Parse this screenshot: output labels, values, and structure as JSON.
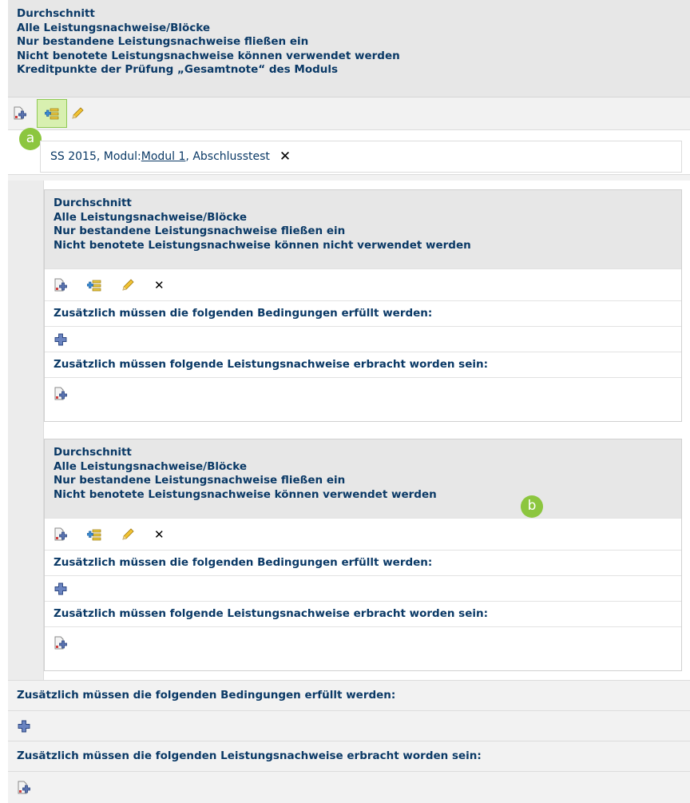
{
  "outer": {
    "header_lines": [
      "Durchschnitt",
      "Alle Leistungsnachweise/Blöcke",
      "Nur bestandene Leistungsnachweise fließen ein",
      "Nicht benotete Leistungsnachweise können verwendet werden",
      "Kreditpunkte der Prüfung „Gesamtnote“ des Moduls"
    ],
    "badge_a": "a",
    "selected": {
      "prefix": "SS 2015, Modul: ",
      "link": "Modul 1",
      "suffix": ", Abschlusstest",
      "remove": "✕"
    },
    "conditions_label": "Zusätzlich müssen die folgenden Bedingungen erfüllt werden:",
    "achievements_label": "Zusätzlich müssen die folgenden Leistungsnachweise erbracht worden sein:"
  },
  "blocks": [
    {
      "header_lines": [
        "Durchschnitt",
        "Alle Leistungsnachweise/Blöcke",
        "Nur bestandene Leistungsnachweise fließen ein",
        "Nicht benotete Leistungsnachweise können nicht verwendet werden"
      ],
      "conditions_label": "Zusätzlich müssen die folgenden Bedingungen erfüllt werden:",
      "achievements_label": "Zusätzlich müssen folgende Leistungsnachweise erbracht worden sein:",
      "remove": "✕"
    },
    {
      "header_lines": [
        "Durchschnitt",
        "Alle Leistungsnachweise/Blöcke",
        "Nur bestandene Leistungsnachweise fließen ein",
        "Nicht benotete Leistungsnachweise können verwendet werden"
      ],
      "badge_b": "b",
      "conditions_label": "Zusätzlich müssen die folgenden Bedingungen erfüllt werden:",
      "achievements_label": "Zusätzlich müssen folgende Leistungsnachweise erbracht worden sein:",
      "remove": "✕"
    }
  ],
  "icons": [
    "add-document-icon",
    "add-list-icon",
    "pencil-icon",
    "remove-icon",
    "add-cross-icon"
  ],
  "colors": {
    "text": "#0a3966",
    "badge": "#8cc63f",
    "highlight": "#d8f0b0"
  }
}
